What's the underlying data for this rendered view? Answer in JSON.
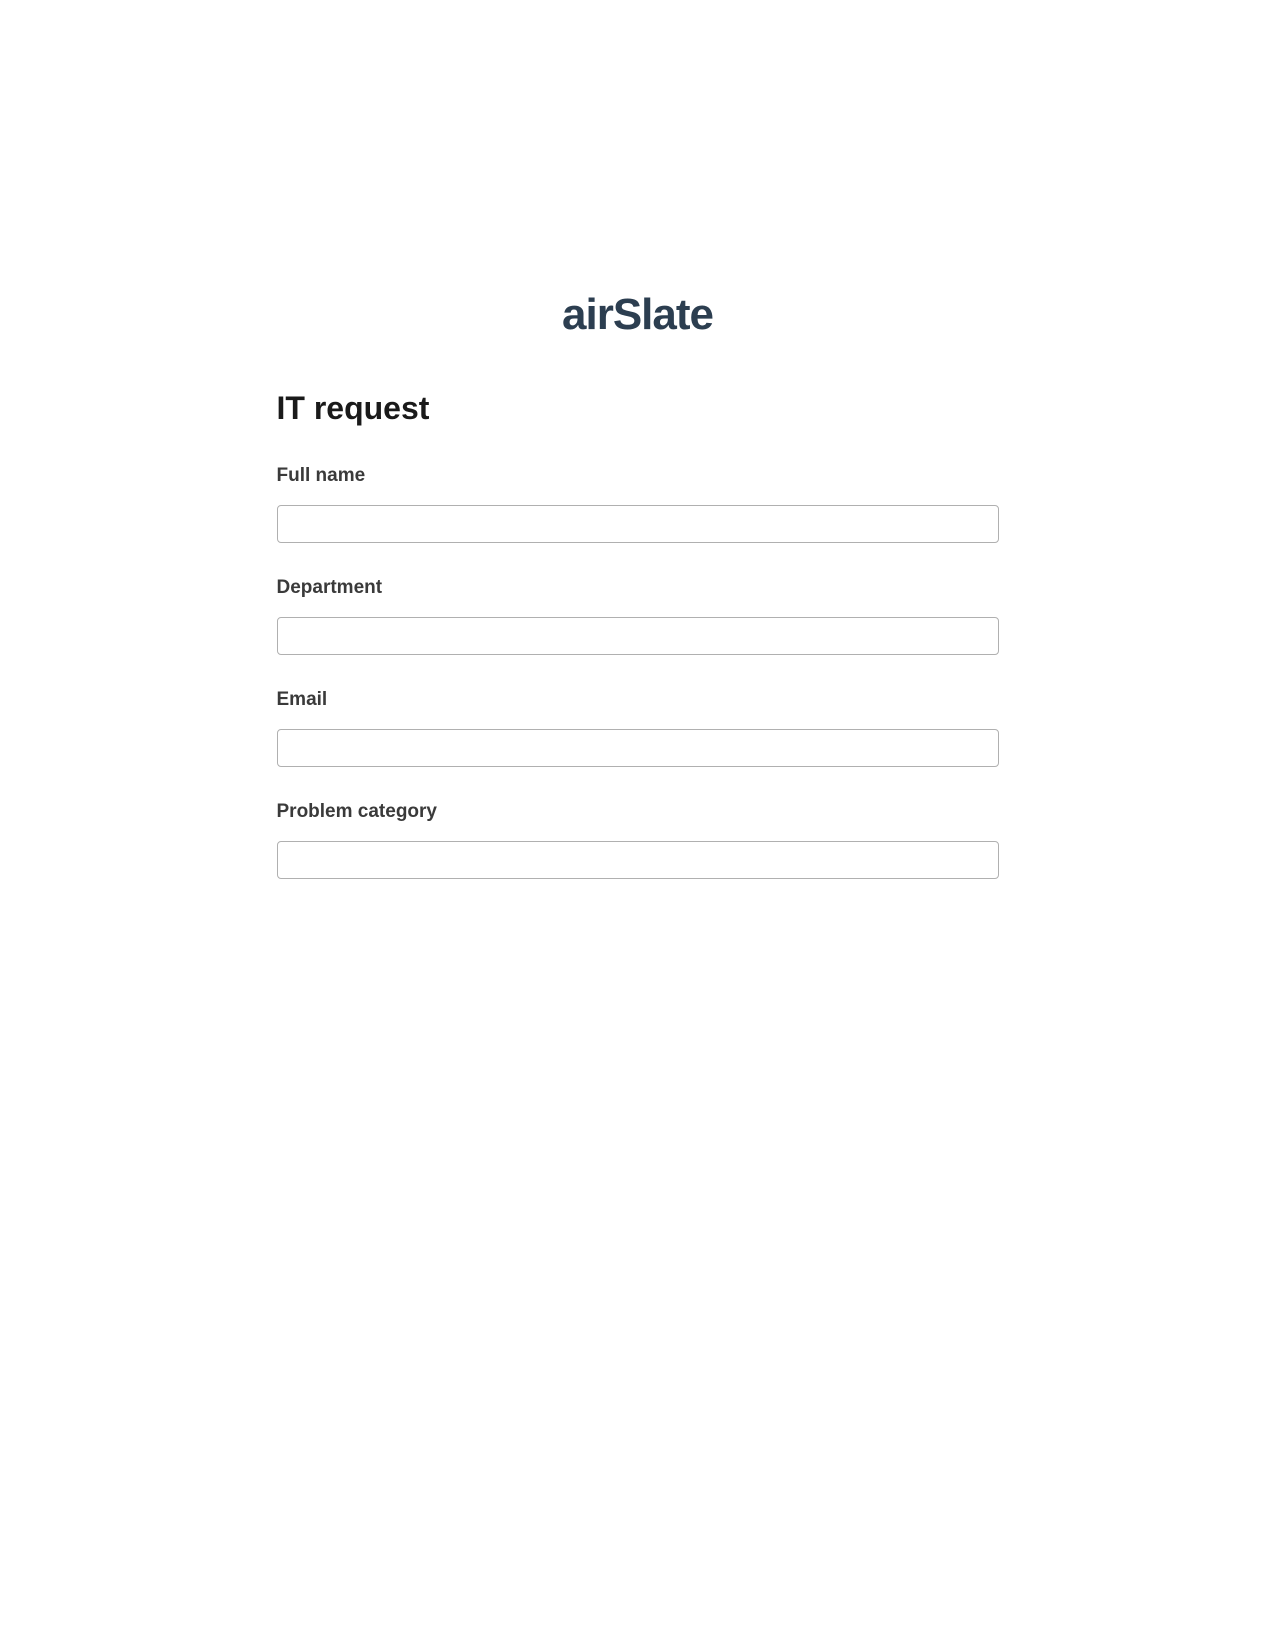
{
  "logo": {
    "part1": "air",
    "part2": "Slate"
  },
  "form": {
    "title": "IT request",
    "fields": [
      {
        "label": "Full name",
        "value": ""
      },
      {
        "label": "Department",
        "value": ""
      },
      {
        "label": "Email",
        "value": ""
      },
      {
        "label": "Problem category",
        "value": ""
      }
    ]
  }
}
